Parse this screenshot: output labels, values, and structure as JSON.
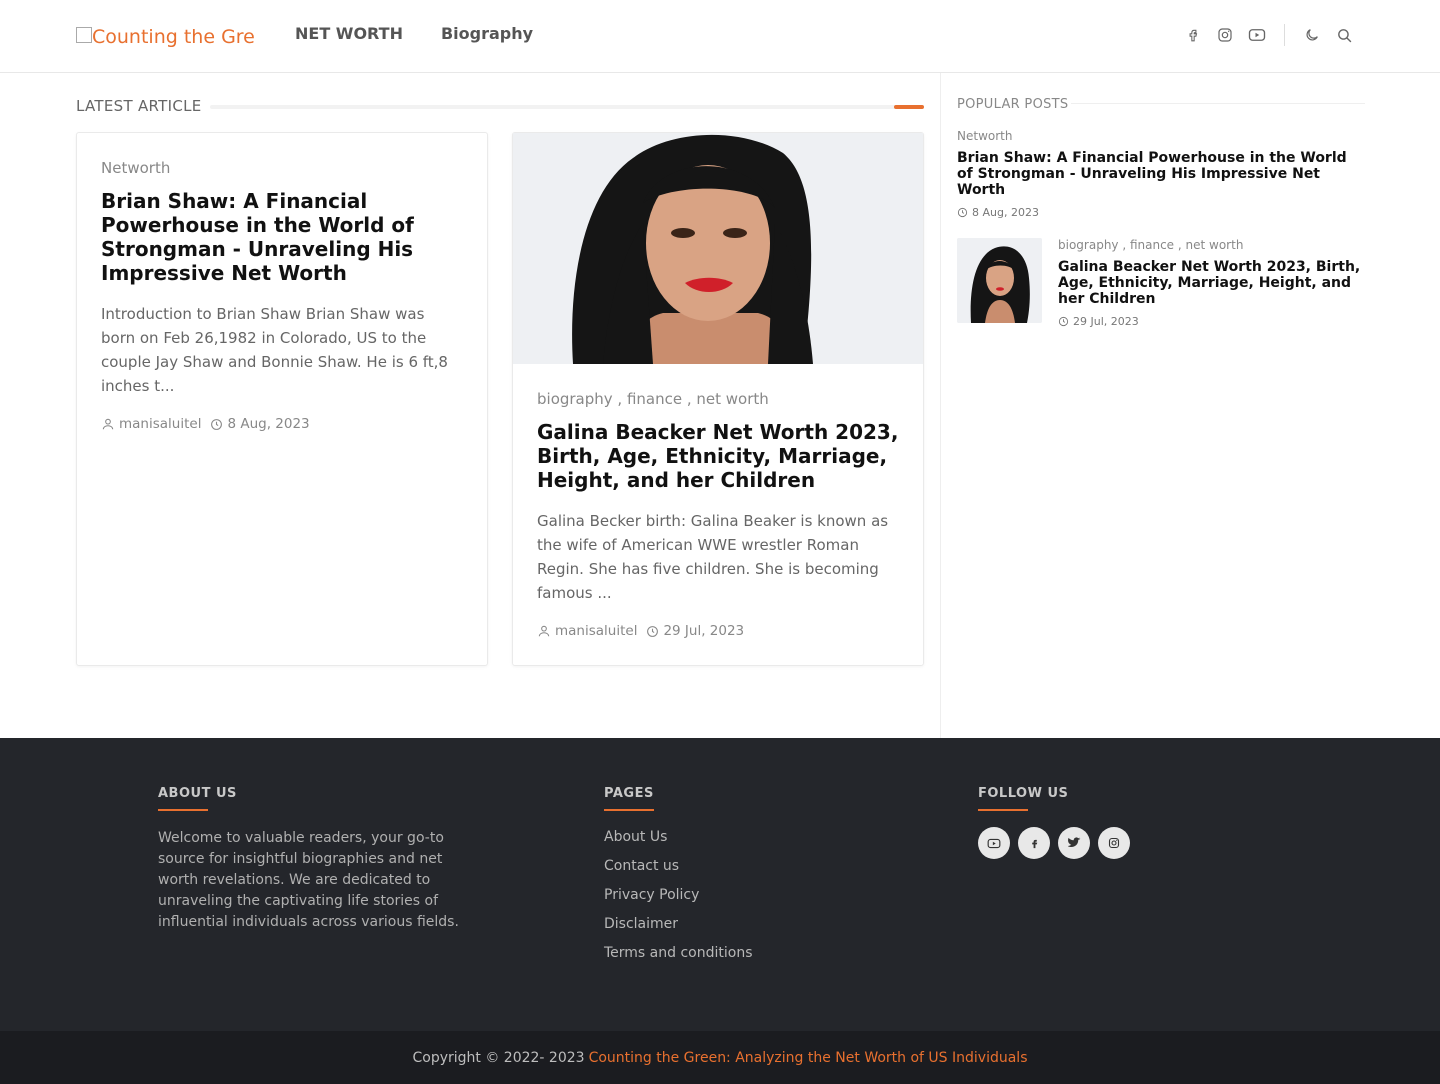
{
  "header": {
    "logo_alt": "Counting the Gre",
    "nav": [
      "NET WORTH",
      "Biography"
    ]
  },
  "icons": {
    "header": [
      "facebook-icon",
      "instagram-icon",
      "youtube-icon",
      "moon-icon",
      "search-icon"
    ],
    "footer_social": [
      "youtube-icon",
      "facebook-icon",
      "twitter-icon",
      "instagram-icon"
    ]
  },
  "colors": {
    "accent": "#e8702f",
    "footer_bg": "#24262b",
    "copyright_bg": "#1b1c20"
  },
  "latest": {
    "title": "LATEST ARTICLE",
    "cards": [
      {
        "category": "Networth",
        "title": "Brian Shaw: A Financial Powerhouse in the World of Strongman - Unraveling His Impressive Net Worth",
        "excerpt": "Introduction to Brian Shaw  Brian Shaw was born on Feb 26,1982 in Colorado, US to the couple Jay Shaw and Bonnie Shaw. He is 6 ft,8 inches t...",
        "author": "manisaluitel",
        "date": "8 Aug, 2023"
      },
      {
        "category": "biography , finance , net worth",
        "title": "Galina Beacker Net Worth 2023, Birth, Age, Ethnicity, Marriage, Height, and her Children",
        "excerpt": "Galina Becker birth: Galina Beaker is known as the wife of American WWE wrestler Roman Regin. She has five children. She is becoming famous ...",
        "author": "manisaluitel",
        "date": "29 Jul, 2023"
      }
    ]
  },
  "popular": {
    "title": "POPULAR POSTS",
    "posts": [
      {
        "category": "Networth",
        "title": "Brian Shaw: A Financial Powerhouse in the World of Strongman - Unraveling His Impressive Net Worth",
        "date": "8 Aug, 2023"
      },
      {
        "category": "biography , finance , net worth",
        "title": "Galina Beacker Net Worth 2023, Birth, Age, Ethnicity, Marriage, Height, and her Children",
        "date": "29 Jul, 2023"
      }
    ]
  },
  "footer": {
    "about": {
      "heading": "ABOUT US",
      "text": "Welcome to valuable readers, your go-to source for insightful biographies and net worth revelations. We are dedicated to unraveling the captivating life stories of influential individuals across various fields."
    },
    "pages": {
      "heading": "PAGES",
      "links": [
        "About Us",
        "Contact us",
        "Privacy Policy",
        "Disclaimer",
        "Terms and conditions"
      ]
    },
    "follow": {
      "heading": "FOLLOW US"
    },
    "copyright": "Copyright © 2022- 2023",
    "site_name": "Counting the Green: Analyzing the Net Worth of US Individuals"
  }
}
